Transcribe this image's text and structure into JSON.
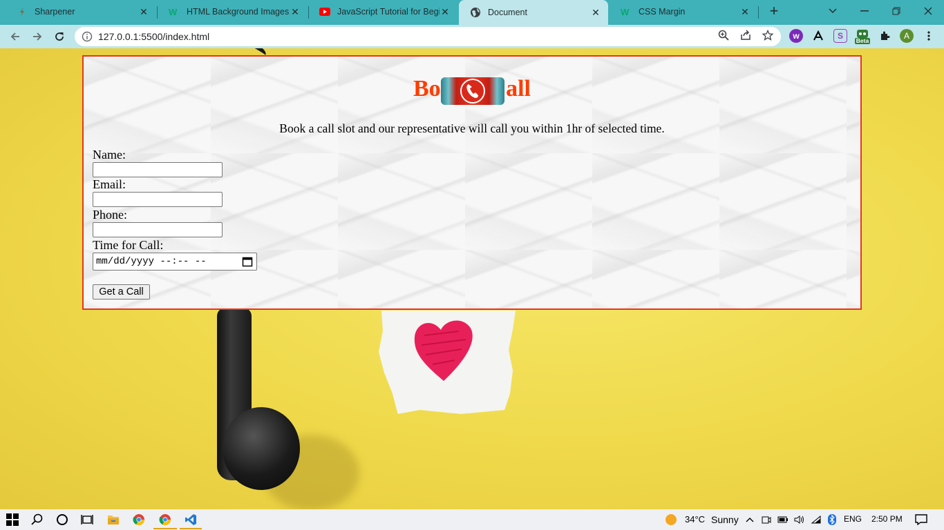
{
  "browser": {
    "tabs": [
      {
        "title": "Sharpener",
        "icon": "sharpener-icon"
      },
      {
        "title": "HTML Background Images",
        "icon": "w3schools-icon"
      },
      {
        "title": "JavaScript Tutorial for Beginne",
        "icon": "youtube-icon"
      },
      {
        "title": "Document",
        "icon": "globe-icon",
        "active": true
      },
      {
        "title": "CSS Margin",
        "icon": "w3schools-icon"
      }
    ],
    "url": "127.0.0.1:5500/index.html",
    "extension_badge": "Beta",
    "profile_initial": "A",
    "colors": {
      "tabstrip": "#3fb1b9",
      "toolbar": "#bfe6ea"
    }
  },
  "page": {
    "heading": "Book a Call",
    "subtitle": "Book a call slot and our representative will call you within 1hr of selected time.",
    "form": {
      "name_label": "Name:",
      "email_label": "Email:",
      "phone_label": "Phone:",
      "time_label": "Time for Call:",
      "datetime_placeholder": "mm/dd/yyyy --:-- --",
      "submit_label": "Get a Call"
    },
    "colors": {
      "heading": "#ff3d00",
      "card_border": "#e8351a",
      "background": "#f1dc4c"
    }
  },
  "taskbar": {
    "weather_temp": "34°C",
    "weather_text": "Sunny",
    "language": "ENG",
    "time": "2:50 PM"
  }
}
